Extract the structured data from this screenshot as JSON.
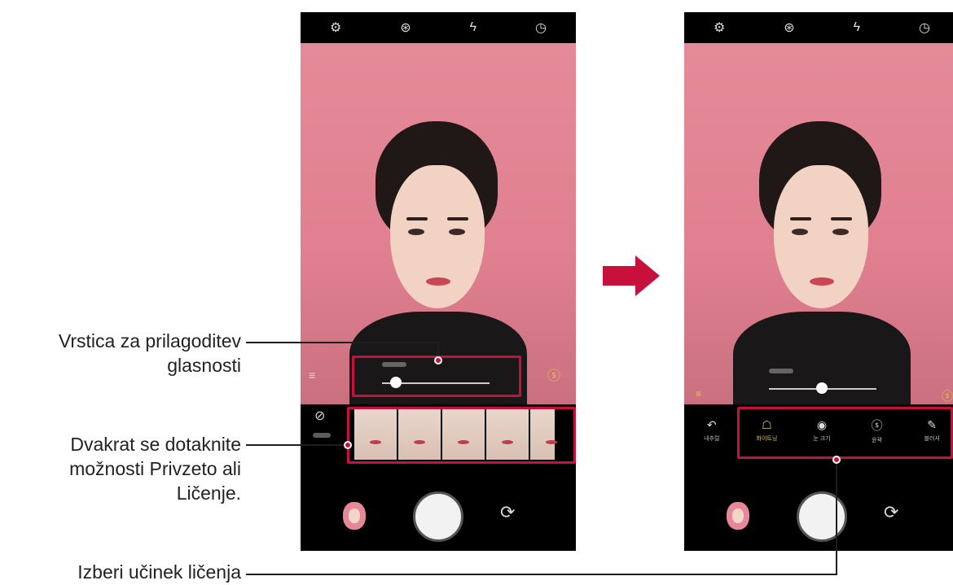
{
  "callouts": {
    "volume_bar_line1": "Vrstica za prilagoditev",
    "volume_bar_line2": "glasnosti",
    "double_tap_line1": "Dvakrat se dotaknite",
    "double_tap_line2": "možnosti Privzeto ali",
    "double_tap_line3": "Ličenje.",
    "choose_effect": "Izberi učinek ličenja"
  },
  "topbar_icons": [
    "settings-icon",
    "filter-icon",
    "flash-off-icon",
    "timer-icon"
  ],
  "topbar_glyphs": [
    "⚙",
    "⊛",
    "ϟ",
    "◷"
  ],
  "right_phone": {
    "effects": [
      {
        "icon": "↶",
        "label": "내추럴",
        "selected": false
      },
      {
        "icon": "☖",
        "label": "화이트닝",
        "selected": true
      },
      {
        "icon": "◉",
        "label": "눈 크기",
        "selected": false
      },
      {
        "icon": "ⓢ",
        "label": "윤곽",
        "selected": false
      },
      {
        "icon": "✎",
        "label": "블러셔",
        "selected": false
      }
    ]
  },
  "colors": {
    "accent": "#c8103c",
    "highlight_text": "#e8c64a",
    "viewport_pink": "#e58a98"
  }
}
